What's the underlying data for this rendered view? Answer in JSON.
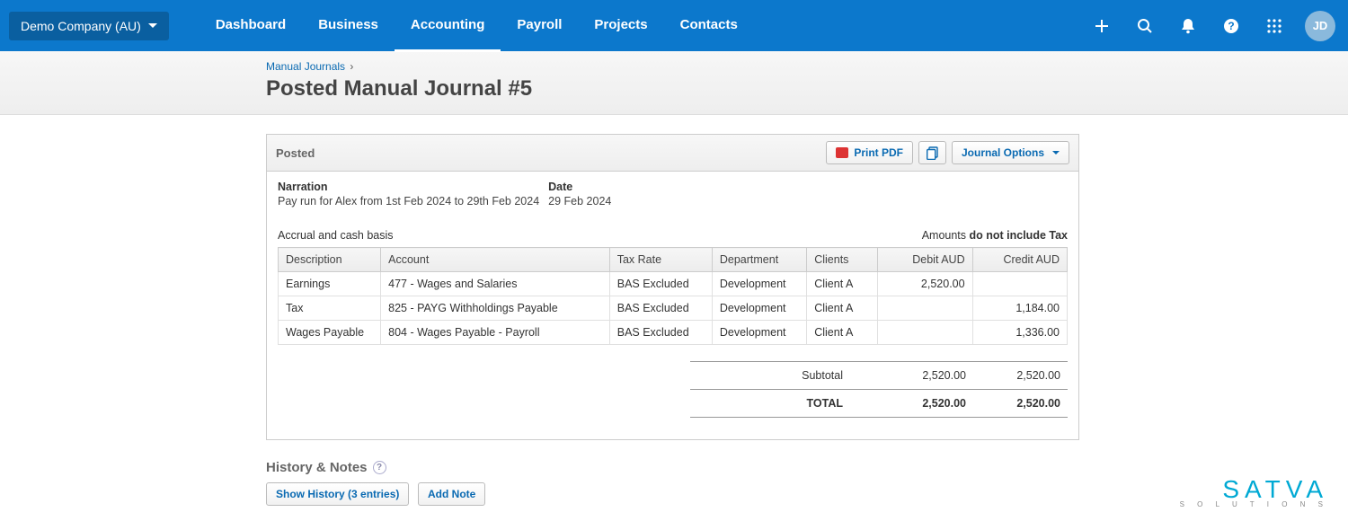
{
  "header": {
    "org_name": "Demo Company (AU)",
    "nav": [
      "Dashboard",
      "Business",
      "Accounting",
      "Payroll",
      "Projects",
      "Contacts"
    ],
    "active_nav_index": 2,
    "avatar_initials": "JD"
  },
  "breadcrumb": {
    "parent": "Manual Journals"
  },
  "page_title": "Posted Manual Journal #5",
  "panel": {
    "status": "Posted",
    "print_label": "Print PDF",
    "options_label": "Journal Options",
    "narration_label": "Narration",
    "narration_value": "Pay run for Alex from 1st Feb 2024 to 29th Feb 2024",
    "date_label": "Date",
    "date_value": "29 Feb 2024",
    "basis_text": "Accrual and cash basis",
    "amounts_prefix": "Amounts ",
    "amounts_bold": "do not include Tax",
    "columns": {
      "description": "Description",
      "account": "Account",
      "tax_rate": "Tax Rate",
      "department": "Department",
      "clients": "Clients",
      "debit": "Debit AUD",
      "credit": "Credit AUD"
    },
    "rows": [
      {
        "description": "Earnings",
        "account": "477 - Wages and Salaries",
        "tax_rate": "BAS Excluded",
        "department": "Development",
        "clients": "Client A",
        "debit": "2,520.00",
        "credit": ""
      },
      {
        "description": "Tax",
        "account": "825 - PAYG Withholdings Payable",
        "tax_rate": "BAS Excluded",
        "department": "Development",
        "clients": "Client A",
        "debit": "",
        "credit": "1,184.00"
      },
      {
        "description": "Wages Payable",
        "account": "804 - Wages Payable - Payroll",
        "tax_rate": "BAS Excluded",
        "department": "Development",
        "clients": "Client A",
        "debit": "",
        "credit": "1,336.00"
      }
    ],
    "subtotal_label": "Subtotal",
    "subtotal_debit": "2,520.00",
    "subtotal_credit": "2,520.00",
    "total_label": "TOTAL",
    "total_debit": "2,520.00",
    "total_credit": "2,520.00"
  },
  "history": {
    "title": "History & Notes",
    "show_history": "Show History (3 entries)",
    "add_note": "Add Note"
  },
  "footer": {
    "brand": "SATVA",
    "tagline": "S O L U T I O N S"
  }
}
